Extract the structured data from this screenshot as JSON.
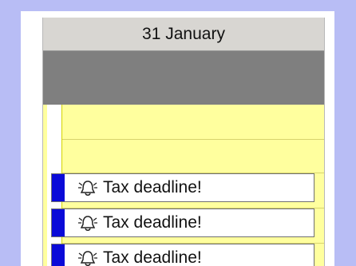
{
  "calendar": {
    "day_label": "31 January",
    "events": [
      {
        "title": "Tax deadline!",
        "icon": "alarm-bell-icon"
      },
      {
        "title": "Tax deadline!",
        "icon": "alarm-bell-icon"
      },
      {
        "title": "Tax deadline!",
        "icon": "alarm-bell-icon"
      }
    ]
  },
  "colors": {
    "background": "#b8bdf5",
    "header": "#d8d6d2",
    "all_day_bar": "#7f7f7f",
    "time_slots": "#ffff9e",
    "event_accent": "#0a0ad8"
  }
}
